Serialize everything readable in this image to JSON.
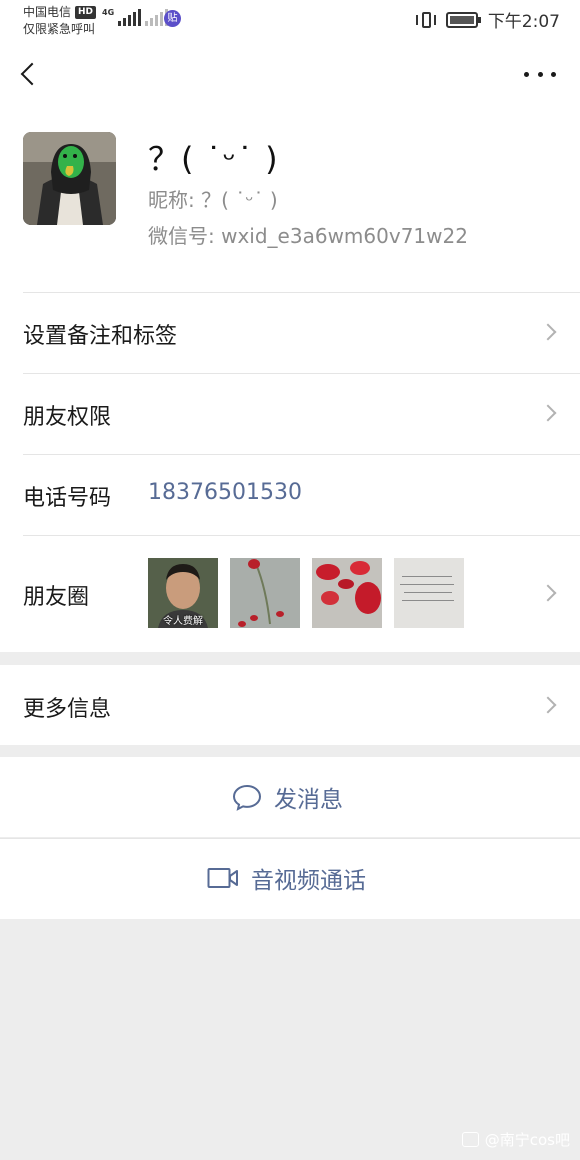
{
  "status_bar": {
    "carrier": "中国电信",
    "hd_badge": "HD",
    "emergency": "仅限紧急呼叫",
    "network": "4G",
    "paste_icon_text": "贴",
    "time": "下午2:07"
  },
  "profile": {
    "name": "？( ˙ᵕ˙ )",
    "nickname_label": "昵称:",
    "nickname_value": "？( ˙ᵕ˙ )",
    "wxid_label": "微信号:",
    "wxid_value": "wxid_e3a6wm60v71w22"
  },
  "menu": {
    "set_remark": "设置备注和标签",
    "friend_permissions": "朋友权限",
    "phone_label": "电话号码",
    "phone_value": "18376501530",
    "moments_label": "朋友圈",
    "moments_thumb1_caption": "令人费解",
    "more_info": "更多信息"
  },
  "actions": {
    "send_message": "发消息",
    "video_call": "音视频通话"
  },
  "watermark": "@南宁cos吧",
  "colors": {
    "link_blue": "#576b95",
    "background": "#ededed"
  }
}
